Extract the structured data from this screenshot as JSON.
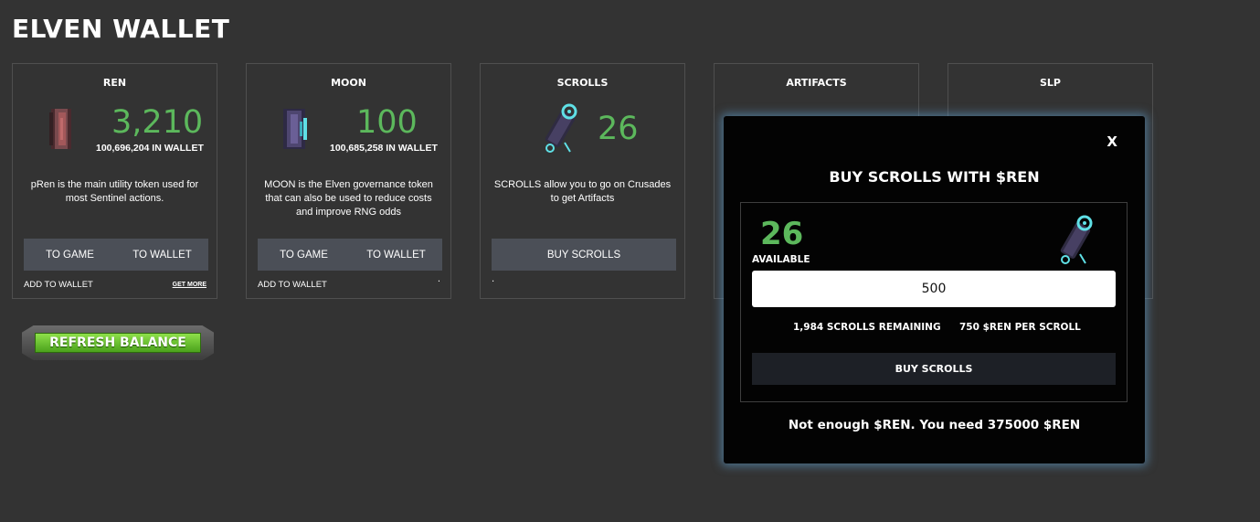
{
  "page": {
    "title": "ELVEN WALLET"
  },
  "cards": [
    {
      "title": "REN",
      "amount": "3,210",
      "wallet": "100,696,204 IN WALLET",
      "description": "pRen is the main utility token used for most Sentinel actions.",
      "buttons": [
        "TO GAME",
        "TO WALLET"
      ],
      "add_link": "ADD TO WALLET",
      "get_more": "GET MORE"
    },
    {
      "title": "MOON",
      "amount": "100",
      "wallet": "100,685,258 IN WALLET",
      "description": "MOON is the Elven governance token that can also be used to reduce costs and improve RNG odds",
      "buttons": [
        "TO GAME",
        "TO WALLET"
      ],
      "add_link": "ADD TO WALLET"
    },
    {
      "title": "SCROLLS",
      "amount": "26",
      "description": "SCROLLS allow you to go on Crusades to get Artifacts",
      "buttons": [
        "BUY SCROLLS"
      ]
    },
    {
      "title": "ARTIFACTS"
    },
    {
      "title": "SLP"
    }
  ],
  "refresh": {
    "label": "REFRESH BALANCE"
  },
  "modal": {
    "close": "X",
    "title": "BUY SCROLLS WITH $REN",
    "available": "26",
    "available_label": "AVAILABLE",
    "quantity": "500",
    "remaining": "1,984 SCROLLS REMAINING",
    "price": "750 $REN PER SCROLL",
    "buy_label": "BUY SCROLLS",
    "message": "Not enough $REN. You need 375000 $REN"
  },
  "colors": {
    "background": "#333333",
    "amount_green": "#5cb85c",
    "button_gray": "#4b4f57",
    "modal_bg": "#030303",
    "modal_glow": "#5fa0d2",
    "refresh_green": "#6cc232"
  }
}
